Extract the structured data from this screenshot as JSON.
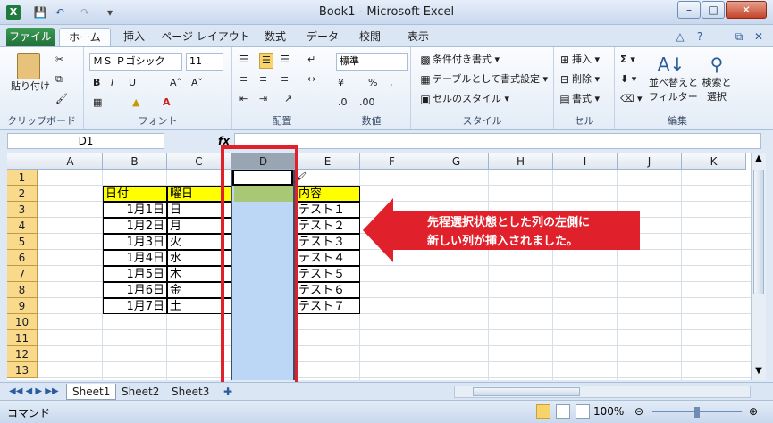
{
  "window": {
    "title": "Book1 - Microsoft Excel",
    "logo": "X"
  },
  "qat": {
    "save_icon": "save-icon",
    "undo_icon": "undo-icon",
    "redo_icon": "redo-icon"
  },
  "tabs": [
    "ファイル",
    "ホーム",
    "挿入",
    "ページ レイアウト",
    "数式",
    "データ",
    "校閲",
    "表示"
  ],
  "ribbon": {
    "clipboard": {
      "label": "クリップボード",
      "paste": "貼り付け"
    },
    "font": {
      "label": "フォント",
      "font_name": "ＭＳ Ｐゴシック",
      "font_size": "11",
      "bold": "B",
      "italic": "I",
      "underline": "U"
    },
    "align": {
      "label": "配置"
    },
    "number": {
      "label": "数値",
      "format": "標準"
    },
    "style": {
      "label": "スタイル",
      "cond": "条件付き書式",
      "table": "テーブルとして書式設定",
      "cell": "セルのスタイル"
    },
    "cells": {
      "label": "セル",
      "insert": "挿入",
      "delete": "削除",
      "format": "書式"
    },
    "edit": {
      "label": "編集",
      "sort": "並べ替えと",
      "sort2": "フィルター",
      "find": "検索と",
      "find2": "選択"
    }
  },
  "formula": {
    "namebox": "D1",
    "fx": "fx",
    "value": ""
  },
  "grid": {
    "columns": [
      "A",
      "B",
      "C",
      "D",
      "E",
      "F",
      "G",
      "H",
      "I",
      "J",
      "K"
    ],
    "rows": [
      "1",
      "2",
      "3",
      "4",
      "5",
      "6",
      "7",
      "8",
      "9",
      "10",
      "11",
      "12",
      "13"
    ],
    "header": {
      "b": "日付",
      "c": "曜日",
      "e": "内容"
    },
    "data": [
      {
        "b": "1月1日",
        "c": "日",
        "e": "テスト１"
      },
      {
        "b": "1月2日",
        "c": "月",
        "e": "テスト２"
      },
      {
        "b": "1月3日",
        "c": "火",
        "e": "テスト３"
      },
      {
        "b": "1月4日",
        "c": "水",
        "e": "テスト４"
      },
      {
        "b": "1月5日",
        "c": "木",
        "e": "テスト５"
      },
      {
        "b": "1月6日",
        "c": "金",
        "e": "テスト６"
      },
      {
        "b": "1月7日",
        "c": "土",
        "e": "テスト７"
      }
    ]
  },
  "annotation": {
    "line1": "先程選択状態とした列の左側に",
    "line2": "新しい列が挿入されました。",
    "color": "#e0202a"
  },
  "sheets": [
    "Sheet1",
    "Sheet2",
    "Sheet3"
  ],
  "status": {
    "mode": "コマンド",
    "zoom": "100%"
  }
}
